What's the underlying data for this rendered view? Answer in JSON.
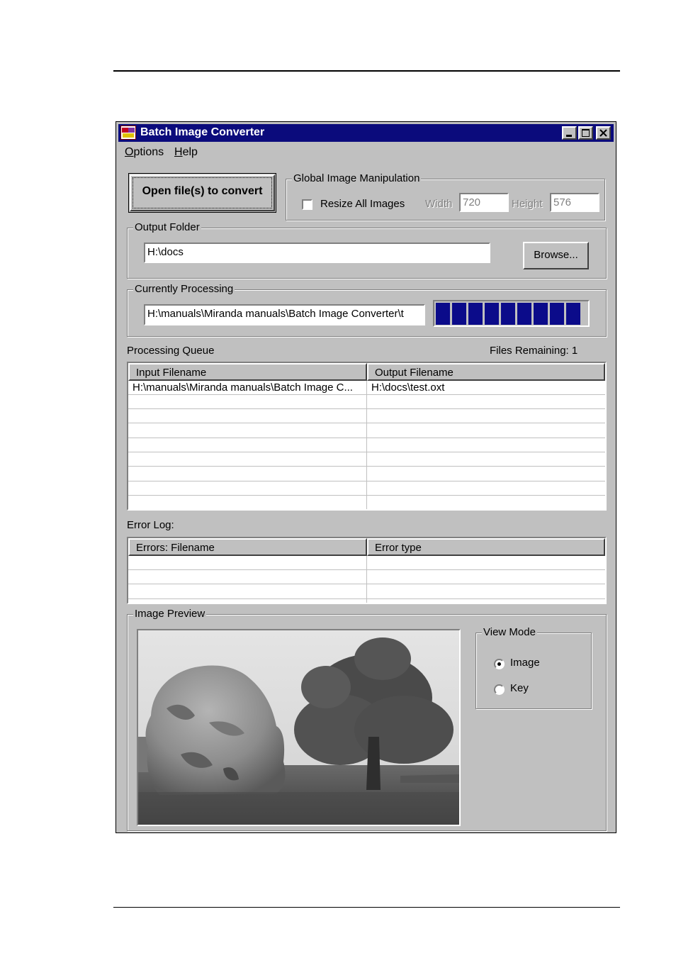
{
  "window": {
    "title": "Batch Image Converter",
    "title_bar_color": "#0b0b7c"
  },
  "menu": [
    {
      "label_ul": "O",
      "label_rest": "ptions"
    },
    {
      "label_ul": "H",
      "label_rest": "elp"
    }
  ],
  "open_button": {
    "label": "Open file(s) to convert"
  },
  "global_manipulation": {
    "legend": "Global Image Manipulation",
    "resize_label": "Resize All Images",
    "resize_checked": false,
    "width_label": "Width",
    "width_value": "720",
    "height_label": "Height",
    "height_value": "576"
  },
  "output_folder": {
    "legend": "Output Folder",
    "path": "H:\\docs",
    "browse_label": "Browse..."
  },
  "currently_processing": {
    "legend": "Currently Processing",
    "path": "H:\\manuals\\Miranda manuals\\Batch Image Converter\\t",
    "progress_percent": 100,
    "progress_color": "#0b0b8a"
  },
  "queue": {
    "label": "Processing Queue",
    "files_remaining_label": "Files Remaining: 1",
    "columns": [
      "Input Filename",
      "Output Filename"
    ],
    "rows": [
      [
        "H:\\manuals\\Miranda manuals\\Batch Image C...",
        "H:\\docs\\test.oxt"
      ],
      [
        "",
        ""
      ],
      [
        "",
        ""
      ],
      [
        "",
        ""
      ],
      [
        "",
        ""
      ],
      [
        "",
        ""
      ],
      [
        "",
        ""
      ],
      [
        "",
        ""
      ]
    ]
  },
  "error_log": {
    "label": "Error Log:",
    "columns": [
      "Errors: Filename",
      "Error type"
    ],
    "rows": [
      [
        "",
        ""
      ],
      [
        "",
        ""
      ],
      [
        "",
        ""
      ]
    ]
  },
  "image_preview": {
    "legend": "Image Preview",
    "view_mode_legend": "View Mode",
    "options": [
      "Image",
      "Key"
    ],
    "selected": "Image"
  }
}
